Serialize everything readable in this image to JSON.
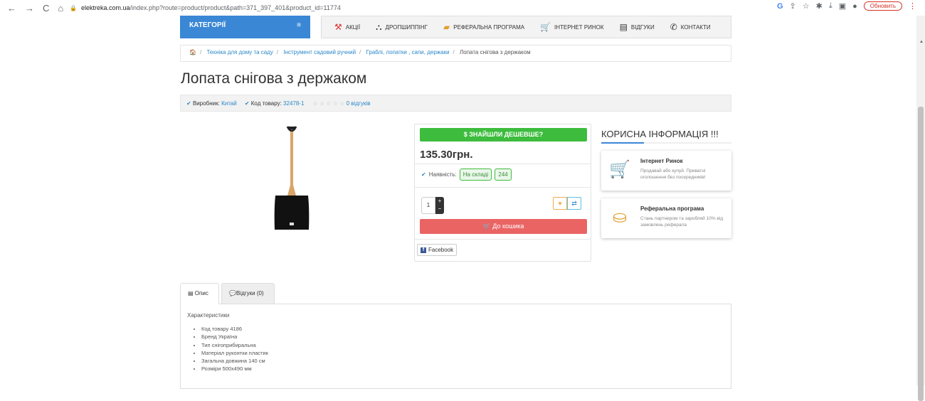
{
  "browser": {
    "back": "←",
    "forward": "→",
    "reload": "C",
    "home": "⌂",
    "host": "elektreka.com.ua",
    "path": "/index.php?route=product/product&path=371_397_401&product_id=11774",
    "update_label": "Обновить"
  },
  "header": {
    "categories_label": "КАТЕГОРІЇ",
    "menu": [
      "АКЦІЇ",
      "ДРОПШИППІНГ",
      "РЕФЕРАЛЬНА ПРОГРАМА",
      "ІНТЕРНЕТ РИНОК",
      "ВІДГУКИ",
      "КОНТАКТИ"
    ]
  },
  "breadcrumb": {
    "items": [
      "Техніка для дому та саду",
      "Інструмент садовий ручний",
      "Граблі, лопатки , сапи, держаки"
    ],
    "current": "Лопата снігова з держаком"
  },
  "product": {
    "title": "Лопата снігова з держаком",
    "manufacturer_label": "Виробник:",
    "manufacturer": "Китай",
    "code_label": "Код товару:",
    "code": "32478-1",
    "reviews_link": "0 відгуків"
  },
  "buybox": {
    "cheaper_label": "$ ЗНАЙШЛИ ДЕШЕВШЕ?",
    "price": "135.30грн.",
    "availability_label": "Наявність:",
    "stock_status": "На складі",
    "stock_count": "244",
    "quantity": "1",
    "cart_label": "До кошика",
    "facebook_label": "Facebook"
  },
  "info": {
    "title": "КОРИСНА ІНФОРМАЦІЯ !!!",
    "cards": [
      {
        "title": "Інтернет Ринок",
        "desc": "Продавай або купуй. Приватні оголошення без посередників!"
      },
      {
        "title": "Реферальна програма",
        "desc": "Стань партнером та заробляй 10% від замовлень реферала"
      }
    ]
  },
  "tabs": {
    "description": "Опис",
    "reviews": "Відгуки (0)"
  },
  "description": {
    "heading": "Характеристики",
    "items": [
      "Код товару 4186",
      "Бренд Україна",
      "Тип снігоприбиральна",
      "Матеріал рукоятки пластик",
      "Загальна довжина 140 см",
      "Розміри 500x490 мм"
    ]
  },
  "colors": {
    "accent": "#3a87d6",
    "green": "#3dbc3d",
    "cart": "#ea6464"
  }
}
